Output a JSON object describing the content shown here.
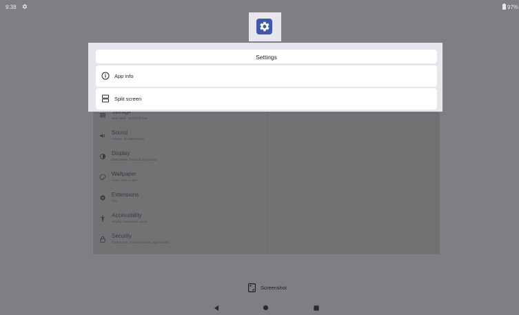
{
  "status_bar": {
    "time": "9:38",
    "battery": "97%"
  },
  "popup_menu": {
    "title": "Settings",
    "items": [
      {
        "label": "App info",
        "icon": "info-icon"
      },
      {
        "label": "Split screen",
        "icon": "split-screen-icon"
      }
    ]
  },
  "settings_list": [
    {
      "title": "Storage",
      "subtitle": "44% used · 35.92 GB free",
      "icon": "storage-icon"
    },
    {
      "title": "Sound",
      "subtitle": "Volume, Do Not Disturb",
      "icon": "sound-icon"
    },
    {
      "title": "Display",
      "subtitle": "Dark theme, font size, brightness",
      "icon": "display-icon"
    },
    {
      "title": "Wallpaper",
      "subtitle": "Home, lock screen",
      "icon": "wallpaper-icon"
    },
    {
      "title": "Extensions",
      "subtitle": "Pen",
      "icon": "extensions-icon"
    },
    {
      "title": "Accessibility",
      "subtitle": "Display, interaction, audio",
      "icon": "accessibility-icon"
    },
    {
      "title": "Security",
      "subtitle": "Screen lock, Find My Device, app security",
      "icon": "security-icon"
    }
  ],
  "screenshot_button": {
    "label": "Screenshot"
  },
  "colors": {
    "scrim": "#7f7e82",
    "app_icon": "#3e5aa8",
    "menu_panel": "#e6e6ec",
    "menu_item": "#ffffff"
  }
}
